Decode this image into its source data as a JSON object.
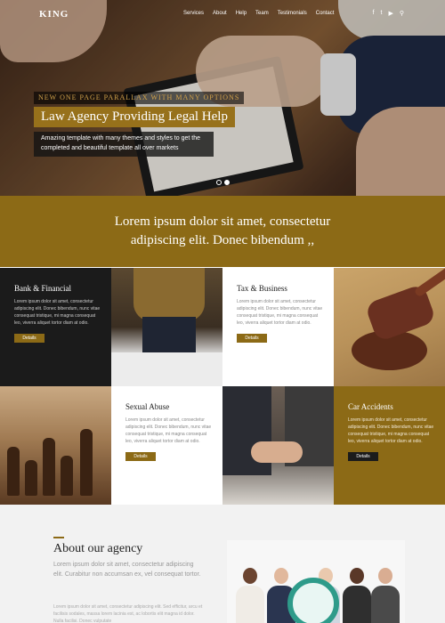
{
  "nav": {
    "logo": "KING",
    "items": [
      "Services",
      "About",
      "Help",
      "Team",
      "Testimonials",
      "Contact"
    ],
    "social_icons": [
      "facebook-icon",
      "twitter-icon",
      "youtube-icon",
      "search-icon"
    ]
  },
  "hero": {
    "tagline": "NEW ONE PAGE PARALLAX WITH MANY OPTIONS",
    "title": "Law Agency Providing Legal Help",
    "text": "Amazing template with many themes and styles to get the completed and beautiful template all over markets",
    "slides": 2,
    "active_slide": 2
  },
  "banner": {
    "line1": "Lorem ipsum dolor sit amet, consectetur",
    "line2": "adipiscing elit. Donec bibendum ,,"
  },
  "services": [
    {
      "title": "Bank & Financial",
      "text": "Lorem ipsum dolor sit amet, consectetur adipiscing elit. Donec bibendum, nunc vitae consequat tristique, mi magna consequat leo, viverra aliquet tortor diam at odio.",
      "button": "Details"
    },
    {
      "title": "Tax & Business",
      "text": "Lorem ipsum dolor sit amet, consectetur adipiscing elit. Donec bibendum, nunc vitae consequat tristique, mi magna consequat leo, viverra aliquet tortor diam at odio.",
      "button": "Details"
    },
    {
      "title": "Sexual Abuse",
      "text": "Lorem ipsum dolor sit amet, consectetur adipiscing elit. Donec bibendum, nunc vitae consequat tristique, mi magna consequat leo, viverra aliquet tortor diam at odio.",
      "button": "Details"
    },
    {
      "title": "Car Accidents",
      "text": "Lorem ipsum dolor sit amet, consectetur adipiscing elit. Donec bibendum, nunc vitae consequat tristique, mi magna consequat leo, viverra aliquet tortor diam at odio.",
      "button": "Details"
    }
  ],
  "about": {
    "title": "About our agency",
    "lead": "Lorem ipsum dolor sit amet, consectetur adipiscing elit. Curabitur non accumsan ex, vel consequat tortor.",
    "body": "Lorem ipsum dolor sit amet, consectetur adipiscing elit. Sed efficitur, arcu et facilisis sodales, massa lorem lacinia est, ac lobortis elit magna id dolor. Nulla facilisi. Donec vulputate"
  },
  "colors": {
    "accent": "#8c6a16",
    "dark": "#1b1b1b",
    "light": "#f2f2f2"
  }
}
